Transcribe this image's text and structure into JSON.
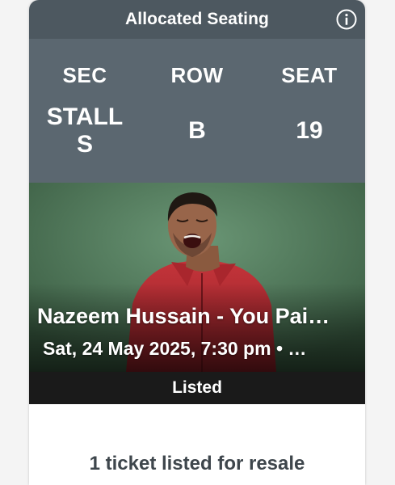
{
  "header": {
    "title": "Allocated Seating",
    "info_icon": "info-icon"
  },
  "seat": {
    "section_label": "SEC",
    "section_value": "STALLS",
    "row_label": "ROW",
    "row_value": "B",
    "seat_label": "SEAT",
    "seat_value": "19"
  },
  "event": {
    "title": "Nazeem Hussain - You Pai…",
    "date": "Sat, 24 May 2025, 7:30 pm • …"
  },
  "status": {
    "label": "Listed"
  },
  "resale": {
    "text": "1 ticket listed for resale"
  },
  "colors": {
    "header_bg": "#4d5860",
    "seat_panel_bg": "#5b6770",
    "status_bar_bg": "#1a1a1a",
    "resale_text": "#3e464c"
  }
}
